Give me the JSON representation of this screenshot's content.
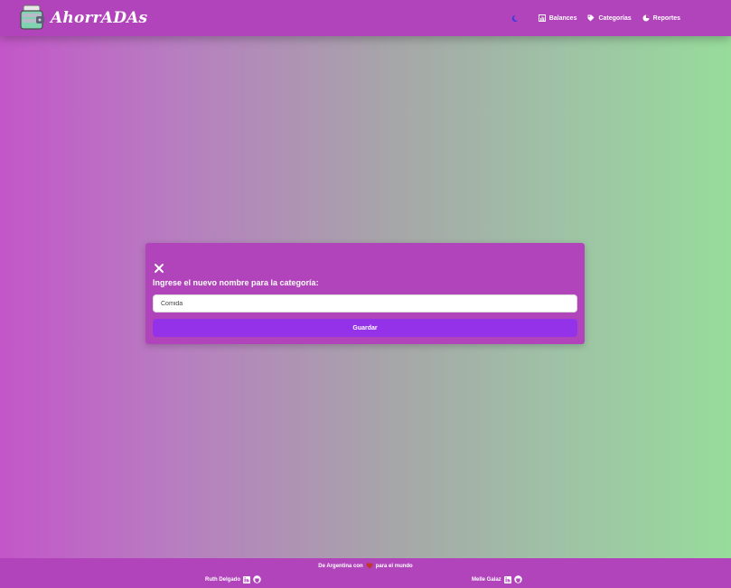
{
  "brand": {
    "name": "AhorrADAs"
  },
  "nav": {
    "theme_icon": "moon-icon",
    "items": [
      {
        "label": "Balances",
        "icon": "chart-icon"
      },
      {
        "label": "Categorías",
        "icon": "tag-icon"
      },
      {
        "label": "Reportes",
        "icon": "pie-chart-icon"
      }
    ]
  },
  "modal": {
    "title": "Ingrese el nuevo nombre para la categoría:",
    "input_value": "Comida",
    "save_label": "Guardar"
  },
  "footer": {
    "tagline_start": "De Argentina con",
    "tagline_end": "para el mundo",
    "authors": [
      {
        "name": "Ruth Delgado"
      },
      {
        "name": "Melle Galaz"
      }
    ]
  },
  "colors": {
    "navbar": "#b144bb",
    "button": "#9332e8",
    "heart": "#c0392b",
    "moon": "#3d3dde"
  }
}
